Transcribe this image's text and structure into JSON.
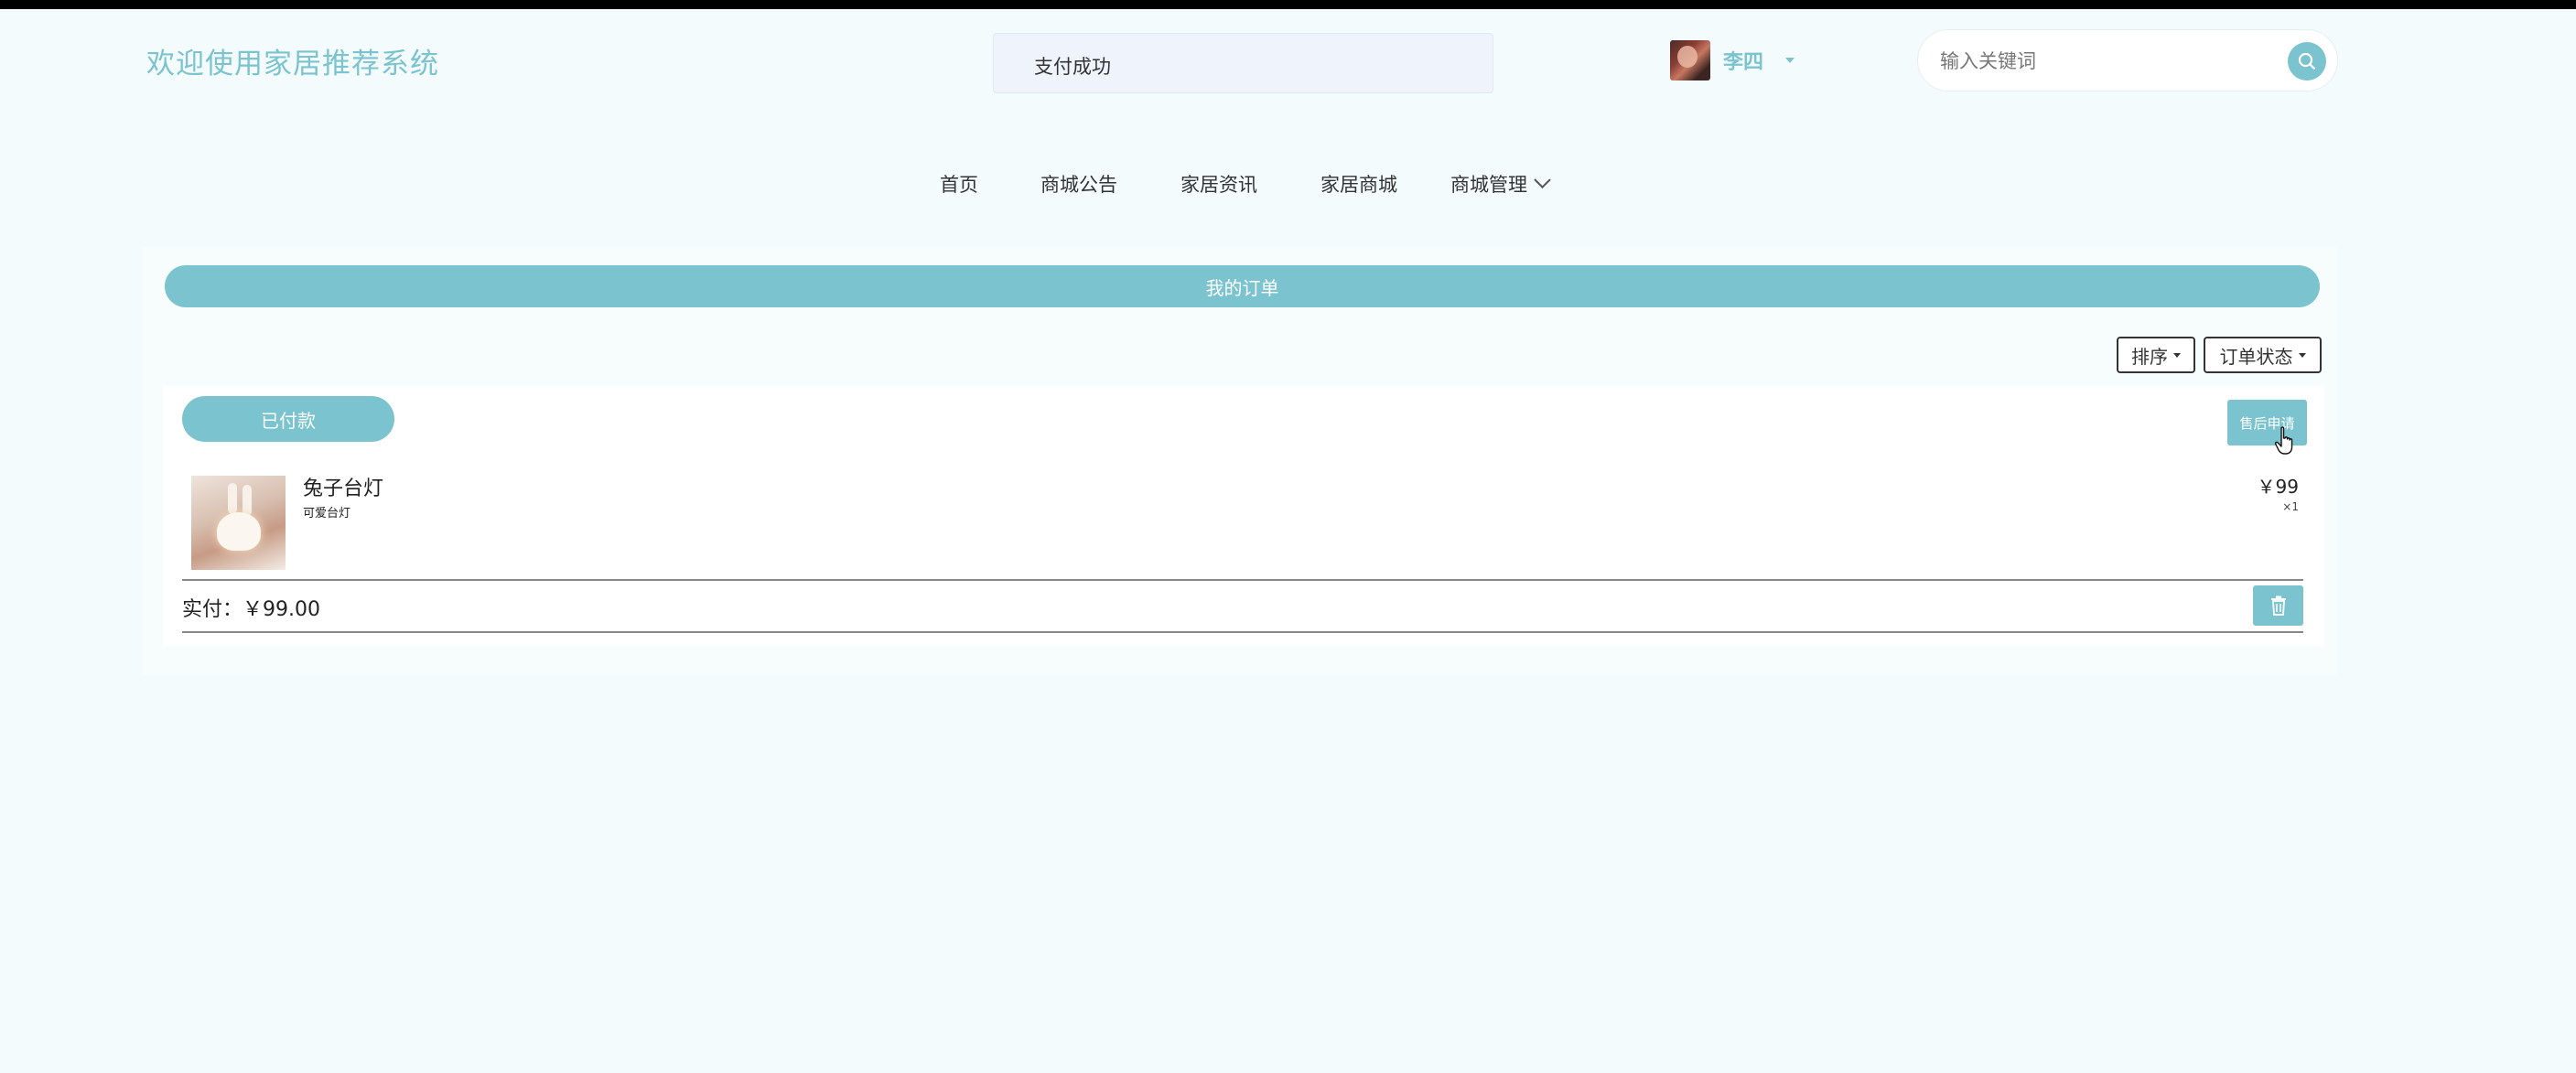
{
  "header": {
    "site_title": "欢迎使用家居推荐系统",
    "toast": "支付成功",
    "user": {
      "name": "李四"
    },
    "search": {
      "placeholder": "输入关键词"
    }
  },
  "nav": {
    "items": [
      {
        "label": "首页"
      },
      {
        "label": "商城公告"
      },
      {
        "label": "家居资讯"
      },
      {
        "label": "家居商城"
      },
      {
        "label": "商城管理"
      }
    ]
  },
  "main": {
    "title": "我的订单",
    "sort_label": "排序",
    "status_filter_label": "订单状态",
    "order": {
      "status": "已付款",
      "after_sale_label": "售后申请",
      "product": {
        "name": "兔子台灯",
        "desc": "可爱台灯",
        "price": "￥99",
        "qty": "×1"
      },
      "paid_label": "实付：￥99.00"
    }
  },
  "colors": {
    "accent": "#7ac3cf",
    "background": "#f3fbfd"
  }
}
